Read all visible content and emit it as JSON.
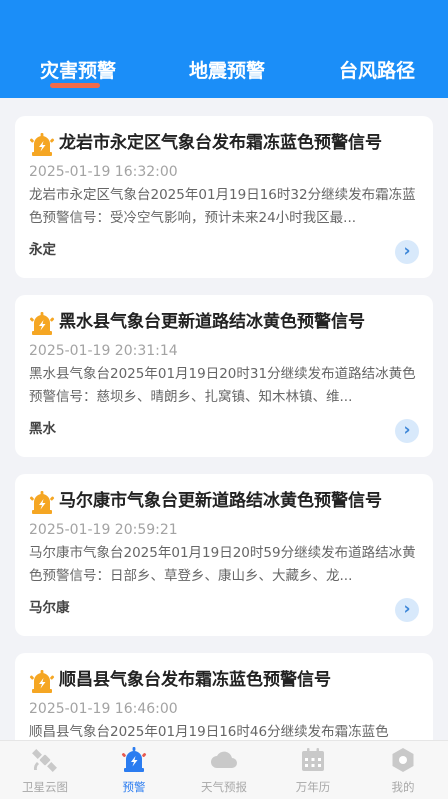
{
  "tabs": [
    "灾害预警",
    "地震预警",
    "台风路径"
  ],
  "warnings": [
    {
      "title": "龙岩市永定区气象台发布霜冻蓝色预警信号",
      "time": "2025-01-19 16:32:00",
      "body": "龙岩市永定区气象台2025年01月19日16时32分继续发布霜冻蓝色预警信号：受冷空气影响，预计未来24小时我区最...",
      "region": "永定"
    },
    {
      "title": "黑水县气象台更新道路结冰黄色预警信号",
      "time": "2025-01-19 20:31:14",
      "body": "黑水县气象台2025年01月19日20时31分继续发布道路结冰黄色预警信号：慈坝乡、晴朗乡、扎窝镇、知木林镇、维...",
      "region": "黑水"
    },
    {
      "title": "马尔康市气象台更新道路结冰黄色预警信号",
      "time": "2025-01-19 20:59:21",
      "body": "马尔康市气象台2025年01月19日20时59分继续发布道路结冰黄色预警信号：日部乡、草登乡、康山乡、大藏乡、龙...",
      "region": "马尔康"
    },
    {
      "title": "顺昌县气象台发布霜冻蓝色预警信号",
      "time": "2025-01-19 16:46:00",
      "body": "顺昌县气象台2025年01月19日16时46分继续发布霜冻蓝色",
      "region": ""
    }
  ],
  "more_symbol": "›",
  "nav": [
    "卫星云图",
    "预警",
    "天气预报",
    "万年历",
    "我的"
  ],
  "colors": {
    "header": "#1b8ef8",
    "tab_indicator": "#f26b4a",
    "warning_icon": "#f5a623",
    "nav_active": "#2b7cf0"
  }
}
